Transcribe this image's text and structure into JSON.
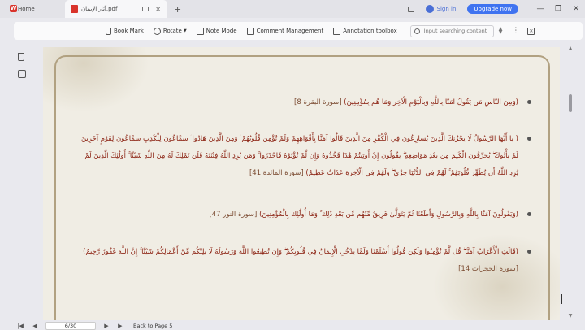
{
  "titlebar": {
    "home_tab": "Home",
    "doc_tab": "آثار الإيمان.pdf",
    "sign_in": "Sign in",
    "upgrade": "Upgrade now"
  },
  "toolbar": {
    "bookmark": "Book Mark",
    "rotate": "Rotate",
    "note_mode": "Note Mode",
    "comment_management": "Comment Management",
    "annotation_toolbox": "Annotation toolbox",
    "search_placeholder": "Input searching content"
  },
  "verses": [
    {
      "text": "(وَمِنَ النَّاسِ مَن يَقُولُ آمَنَّا بِاللَّهِ وَبِالْيَوْمِ الْآخِرِ وَمَا هُم بِمُؤْمِنِينَ)",
      "ref": "[سورة البقرة 8]"
    },
    {
      "text": "( يَا أَيُّهَا الرَّسُولُ لَا يَحْزُنكَ الَّذِينَ يُسَارِعُونَ فِي الْكُفْرِ مِنَ الَّذِينَ قَالُوا آمَنَّا بِأَفْوَاهِهِمْ وَلَمْ تُؤْمِن قُلُوبُهُمْ ۛ وَمِنَ الَّذِينَ هَادُوا ۛ سَمَّاعُونَ لِلْكَذِبِ سَمَّاعُونَ لِقَوْمٍ آخَرِينَ لَمْ يَأْتُوكَ ۖ يُحَرِّفُونَ الْكَلِمَ مِن بَعْدِ مَوَاضِعِهِ ۖ يَقُولُونَ إِنْ أُوتِيتُمْ هَٰذَا فَخُذُوهُ وَإِن لَّمْ تُؤْتَوْهُ فَاحْذَرُوا ۚ وَمَن يُرِدِ اللَّهُ فِتْنَتَهُ فَلَن تَمْلِكَ لَهُ مِنَ اللَّهِ شَيْئًا ۚ أُولَٰئِكَ الَّذِينَ لَمْ يُرِدِ اللَّهُ أَن يُطَهِّرَ قُلُوبَهُمْ ۚ لَهُمْ فِي الدُّنْيَا خِزْيٌ ۖ وَلَهُمْ فِي الْآخِرَةِ عَذَابٌ عَظِيمٌ)",
      "ref": "[سورة المائدة 41]"
    },
    {
      "text": "(وَيَقُولُونَ آمَنَّا بِاللَّهِ وَبِالرَّسُولِ وَأَطَعْنَا ثُمَّ يَتَوَلَّىٰ فَرِيقٌ مِّنْهُم مِّن بَعْدِ ذَٰلِكَ ۚ وَمَا أُولَٰئِكَ بِالْمُؤْمِنِينَ)",
      "ref": "[سورة النور 47]"
    },
    {
      "text": "(قَالَتِ الْأَعْرَابُ آمَنَّا ۖ قُل لَّمْ تُؤْمِنُوا وَلَٰكِن قُولُوا أَسْلَمْنَا وَلَمَّا يَدْخُلِ الْإِيمَانُ فِي قُلُوبِكُمْ ۖ وَإِن تُطِيعُوا اللَّهَ وَرَسُولَهُ لَا يَلِتْكُم مِّنْ أَعْمَالِكُمْ شَيْئًا ۚ إِنَّ اللَّهَ غَفُورٌ رَّحِيمٌ)",
      "ref": "[سورة الحجرات 14]"
    }
  ],
  "status": {
    "page_indicator": "6/30",
    "back_to_page": "Back to Page 5"
  },
  "colors": {
    "accent": "#3f73f0",
    "verse_text": "#8a1f0f",
    "frame": "#b1a181",
    "page_bg": "#f0ede4"
  }
}
